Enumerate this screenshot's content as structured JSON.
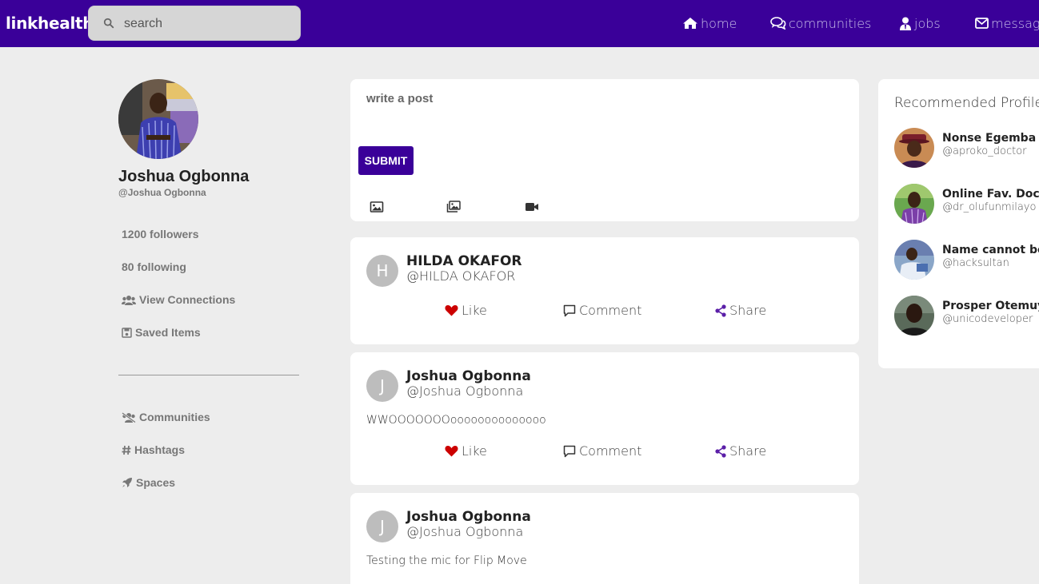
{
  "header": {
    "brand": "linkhealth",
    "search_placeholder": "search",
    "nav": {
      "home": "home",
      "communities": "communities",
      "jobs": "jobs",
      "messages": "message"
    }
  },
  "profile": {
    "name": "Joshua Ogbonna",
    "handle": "@Joshua Ogbonna",
    "followers": "1200 followers",
    "following": "80 following",
    "view_connections": "View Connections",
    "saved_items": "Saved Items",
    "communities": "Communities",
    "hashtags": "Hashtags",
    "spaces": "Spaces"
  },
  "composer": {
    "placeholder": "write a post",
    "submit_label": "SUBMIT"
  },
  "actions": {
    "like": "Like",
    "comment": "Comment",
    "share": "Share"
  },
  "posts": [
    {
      "initial": "H",
      "name": "HILDA OKAFOR",
      "handle": "@HILDA OKAFOR",
      "text": ""
    },
    {
      "initial": "J",
      "name": "Joshua Ogbonna",
      "handle": "@Joshua Ogbonna",
      "text": "WWOOOOOOOoooooooooooooo"
    },
    {
      "initial": "J",
      "name": "Joshua Ogbonna",
      "handle": "@Joshua Ogbonna",
      "text": "Testing the mic for Flip Move"
    }
  ],
  "recommended": {
    "title": "Recommended Profiles",
    "profiles": [
      {
        "name": "Nonse Egemba",
        "handle": "@aproko_doctor"
      },
      {
        "name": "Online Fav. Doctor",
        "handle": "@dr_olufunmilayo"
      },
      {
        "name": "Name cannot be blank",
        "handle": "@hacksultan"
      },
      {
        "name": "Prosper Otemuyiwa",
        "handle": "@unicodeveloper"
      }
    ]
  },
  "colors": {
    "brand": "#3a0099",
    "like_heart": "#cc0000",
    "share_icon": "#5b1fa8"
  }
}
